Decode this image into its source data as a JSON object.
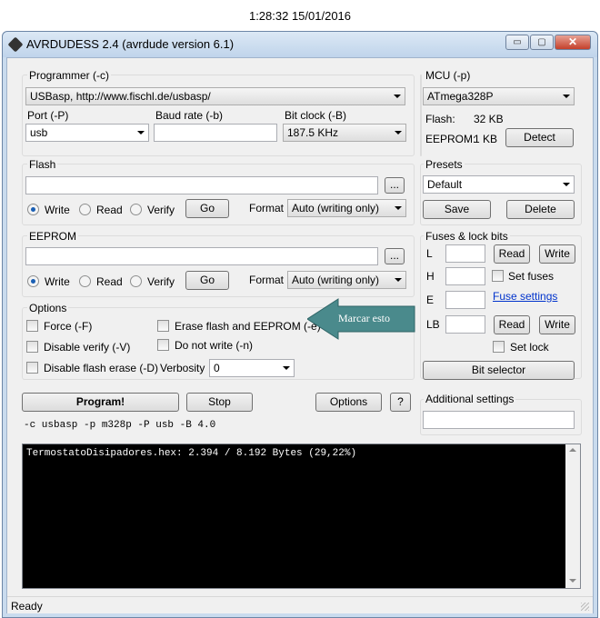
{
  "timestamp": "1:28:32 15/01/2016",
  "window": {
    "title": "AVRDUDESS 2.4 (avrdude version 6.1)",
    "min": "▭",
    "max": "▢",
    "close": "✕"
  },
  "programmer": {
    "group": "Programmer (-c)",
    "value": "USBasp, http://www.fischl.de/usbasp/",
    "port_label": "Port (-P)",
    "port_value": "usb",
    "baud_label": "Baud rate (-b)",
    "baud_value": "",
    "bitclock_label": "Bit clock (-B)",
    "bitclock_value": "187.5 KHz"
  },
  "mcu": {
    "group": "MCU (-p)",
    "value": "ATmega328P",
    "flash_label": "Flash:",
    "flash_value": "32 KB",
    "eeprom_label": "EEPROM:",
    "eeprom_value": "1 KB",
    "detect": "Detect"
  },
  "flash": {
    "group": "Flash",
    "file": "",
    "browse": "...",
    "write": "Write",
    "read": "Read",
    "verify": "Verify",
    "go": "Go",
    "format_label": "Format",
    "format_value": "Auto (writing only)"
  },
  "eeprom": {
    "group": "EEPROM",
    "file": "",
    "browse": "...",
    "write": "Write",
    "read": "Read",
    "verify": "Verify",
    "go": "Go",
    "format_label": "Format",
    "format_value": "Auto (writing only)"
  },
  "presets": {
    "group": "Presets",
    "value": "Default",
    "save": "Save",
    "delete": "Delete"
  },
  "fuses": {
    "group": "Fuses & lock bits",
    "l": "L",
    "h": "H",
    "e": "E",
    "lb": "LB",
    "read": "Read",
    "write": "Write",
    "set_fuses": "Set fuses",
    "fuse_settings": "Fuse settings",
    "set_lock": "Set lock",
    "bit_selector": "Bit selector"
  },
  "options": {
    "group": "Options",
    "force": "Force (-F)",
    "disable_verify": "Disable verify (-V)",
    "disable_flash_erase": "Disable flash erase (-D)",
    "erase": "Erase flash and EEPROM (-e)",
    "do_not_write": "Do not write (-n)",
    "verbosity_label": "Verbosity",
    "verbosity_value": "0"
  },
  "annotation": {
    "text": "Marcar esto",
    "color": "#4a8a8c"
  },
  "actions": {
    "program": "Program!",
    "stop": "Stop",
    "options": "Options",
    "help": "?"
  },
  "additional": {
    "group": "Additional settings",
    "value": ""
  },
  "command_line": "-c usbasp -p m328p -P usb -B 4.0",
  "console": {
    "text": "TermostatoDisipadores.hex: 2.394 / 8.192 Bytes (29,22%)"
  },
  "status": "Ready"
}
